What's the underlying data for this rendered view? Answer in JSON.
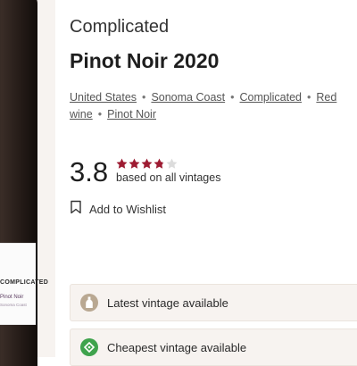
{
  "bottle": {
    "label_brand": "COMPLICATED",
    "label_variety": "Pinot Noir",
    "label_region": "Sonoma Coast"
  },
  "header": {
    "winery": "Complicated",
    "title": "Pinot Noir 2020"
  },
  "breadcrumb": [
    "United States",
    "Sonoma Coast",
    "Complicated",
    "Red wine",
    "Pinot Noir"
  ],
  "rating": {
    "score": "3.8",
    "caption": "based on all vintages",
    "stars_filled": 3.8,
    "stars_total": 5,
    "star_color": "#9e1b32",
    "star_empty_color": "#dcdcdc"
  },
  "wishlist": {
    "label": "Add to Wishlist",
    "icon": "bookmark-icon"
  },
  "vintages": [
    {
      "label": "Latest vintage available",
      "icon": "bottle-icon",
      "icon_bg": "#b9a892"
    },
    {
      "label": "Cheapest vintage available",
      "icon": "price-tag-icon",
      "icon_bg": "#3fa34d"
    }
  ]
}
